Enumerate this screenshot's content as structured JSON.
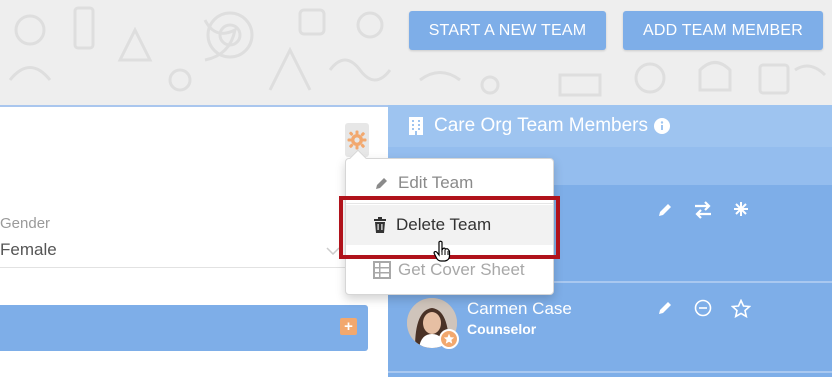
{
  "header": {
    "start_team_label": "START A NEW TEAM",
    "add_member_label": "ADD TEAM MEMBER"
  },
  "left": {
    "gender_label": "Gender",
    "gender_value": "Female"
  },
  "right": {
    "title": "Care Org Team Members",
    "members": [
      {
        "name": "Carmen Case",
        "role": "Counselor"
      }
    ]
  },
  "dropdown": {
    "edit_label": "Edit Team",
    "delete_label": "Delete Team",
    "cover_label": "Get Cover Sheet"
  },
  "colors": {
    "accent_blue": "#7eaee8",
    "header_blue": "#9ec4f0",
    "orange": "#f2a86e",
    "highlight_red": "#b0121b"
  },
  "icons": [
    "gear-icon",
    "pencil-icon",
    "trash-icon",
    "spreadsheet-icon",
    "building-icon",
    "info-icon",
    "transfer-icon",
    "snowflake-icon",
    "minus-circle-icon",
    "star-icon",
    "plus-icon"
  ]
}
